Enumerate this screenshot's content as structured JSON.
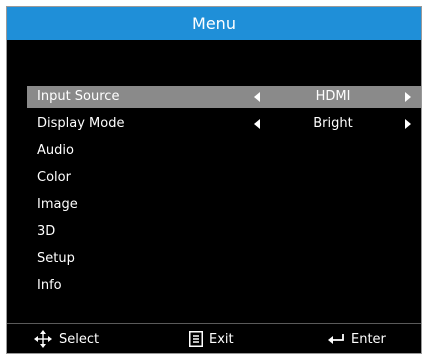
{
  "menu": {
    "title": "Menu",
    "items": [
      {
        "label": "Input Source",
        "value": "HDMI",
        "has_arrows": true,
        "selected": true
      },
      {
        "label": "Display Mode",
        "value": "Bright",
        "has_arrows": true,
        "selected": false
      },
      {
        "label": "Audio"
      },
      {
        "label": "Color"
      },
      {
        "label": "Image"
      },
      {
        "label": "3D"
      },
      {
        "label": "Setup"
      },
      {
        "label": "Info"
      }
    ]
  },
  "footer": {
    "select_label": "Select",
    "exit_label": "Exit",
    "enter_label": "Enter",
    "select_icon": "directional-pad-icon",
    "exit_icon": "menu-button-icon",
    "enter_icon": "enter-return-icon"
  },
  "colors": {
    "title_bar": "#1f8fd8",
    "selection_highlight": "#8a8a8a",
    "background": "#000000",
    "text": "#ffffff"
  }
}
